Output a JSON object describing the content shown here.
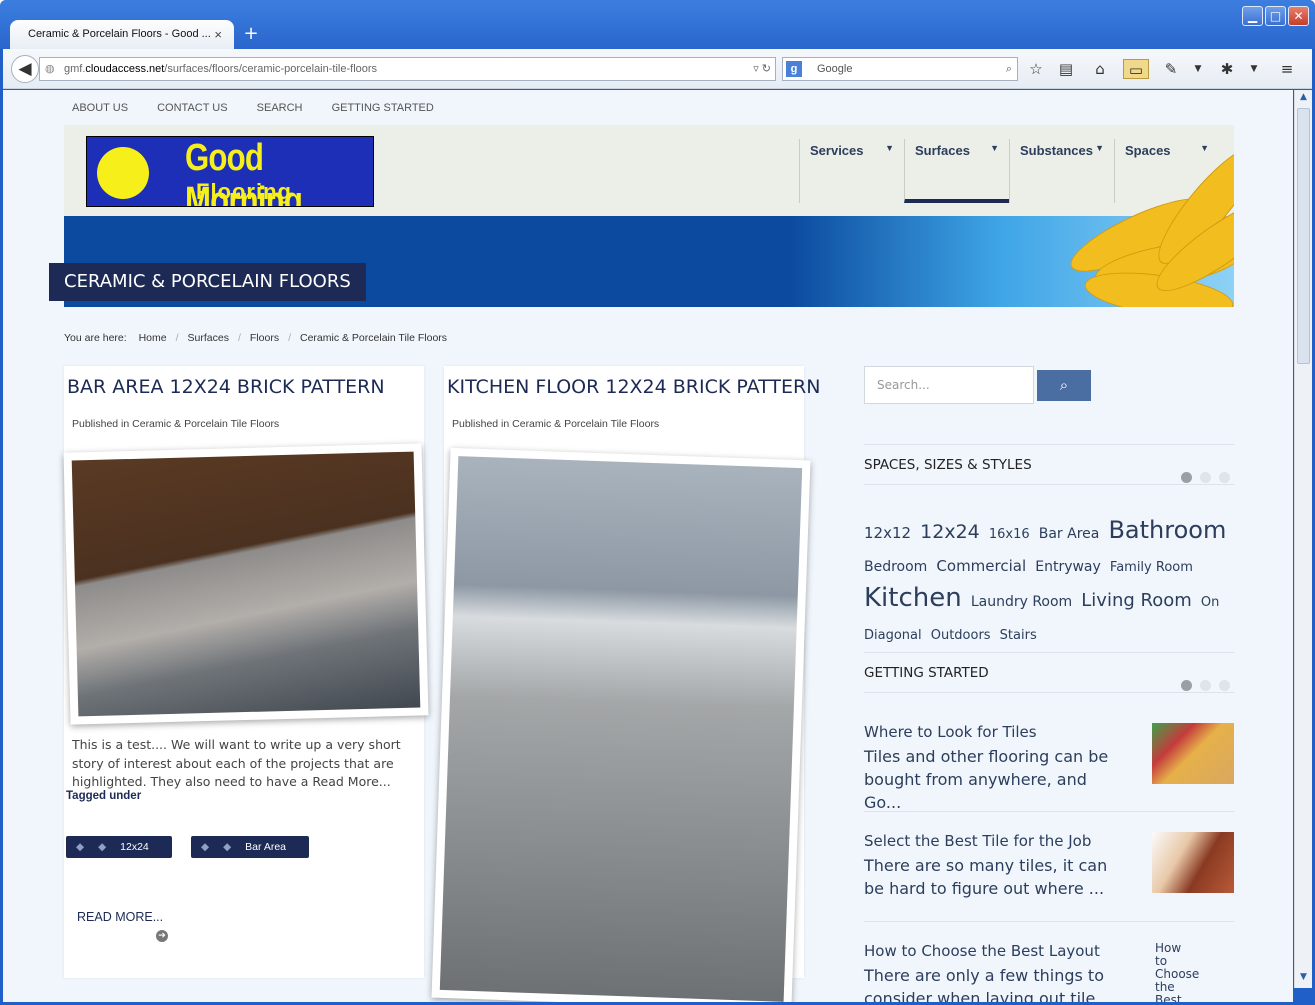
{
  "browser": {
    "tab_title": "Ceramic & Porcelain Floors - Good ...",
    "tab_close": "×",
    "new_tab": "+",
    "url_prefix": "gmf.",
    "url_domain": "cloudaccess.net",
    "url_path": "/surfaces/floors/ceramic-porcelain-tile-floors",
    "search_engine": "Google",
    "window_buttons": {
      "min": "▁",
      "max": "□",
      "close": "✕"
    }
  },
  "site": {
    "top_nav": [
      "ABOUT US",
      "CONTACT US",
      "SEARCH",
      "GETTING STARTED"
    ],
    "logo_line1": "Good Morning",
    "logo_line2": "Flooring",
    "menu": [
      "Services",
      "Surfaces",
      "Substances",
      "Spaces"
    ],
    "active_menu": "Surfaces",
    "page_title": "CERAMIC & PORCELAIN FLOORS",
    "breadcrumb": {
      "label": "You are here:",
      "items": [
        "Home",
        "Surfaces",
        "Floors",
        "Ceramic & Porcelain Tile Floors"
      ]
    }
  },
  "articles": [
    {
      "title": "BAR AREA 12X24 BRICK PATTERN",
      "published_prefix": "Published in",
      "category": "Ceramic & Porcelain Tile Floors",
      "excerpt": "This is a test.... We will want to write up a very short story of interest about each of the projects that are highlighted. They also need to have a Read More...",
      "tagged_label": "Tagged under",
      "tags": [
        "12x24",
        "Bar Area"
      ],
      "read_more": "READ MORE..."
    },
    {
      "title": "KITCHEN FLOOR 12X24 BRICK PATTERN",
      "published_prefix": "Published in",
      "category": "Ceramic & Porcelain Tile Floors"
    }
  ],
  "sidebar": {
    "search_placeholder": "Search...",
    "widget1_title": "SPACES, SIZES & STYLES",
    "tag_cloud": [
      {
        "label": "12x12",
        "size": 15
      },
      {
        "label": "12x24",
        "size": 19
      },
      {
        "label": "16x16",
        "size": 13
      },
      {
        "label": "Bar Area",
        "size": 14
      },
      {
        "label": "Bathroom",
        "size": 24
      },
      {
        "label": "Bedroom",
        "size": 14
      },
      {
        "label": "Commercial",
        "size": 15
      },
      {
        "label": "Entryway",
        "size": 14
      },
      {
        "label": "Family Room",
        "size": 13
      },
      {
        "label": "Kitchen",
        "size": 26
      },
      {
        "label": "Laundry Room",
        "size": 14
      },
      {
        "label": "Living Room",
        "size": 18
      },
      {
        "label": "On Diagonal",
        "size": 13
      },
      {
        "label": "Outdoors",
        "size": 13
      },
      {
        "label": "Stairs",
        "size": 13
      }
    ],
    "widget2_title": "GETTING STARTED",
    "getting_started": [
      {
        "title": "Where to Look for Tiles",
        "desc": "Tiles and other flooring can be bought from anywhere, and Go..."
      },
      {
        "title": "Select the Best Tile for the Job",
        "desc": "There are so many tiles, it can be hard to figure out where ..."
      },
      {
        "title": "How to Choose the Best Layout",
        "desc": "There are only a few things to consider when laying out tile",
        "thumb_alt": "How to Choose the Best"
      }
    ]
  }
}
